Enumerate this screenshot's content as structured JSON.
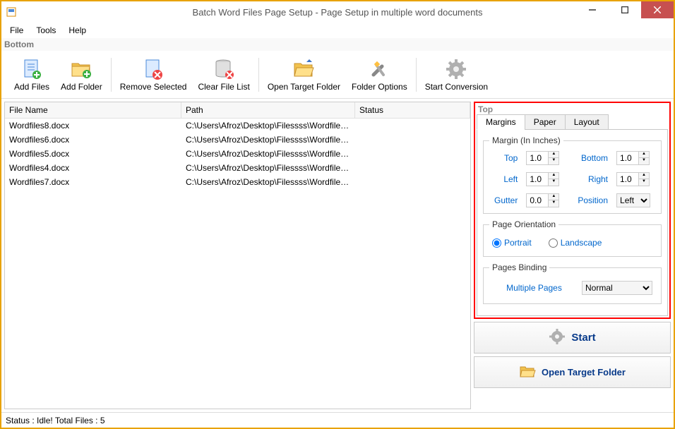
{
  "window": {
    "title": "Batch Word Files Page Setup - Page Setup in multiple word documents"
  },
  "menu": {
    "file": "File",
    "tools": "Tools",
    "help": "Help"
  },
  "labels": {
    "bottom": "Bottom",
    "top": "Top"
  },
  "toolbar": {
    "add_files": "Add Files",
    "add_folder": "Add Folder",
    "remove_selected": "Remove Selected",
    "clear_file_list": "Clear File List",
    "open_target_folder": "Open Target Folder",
    "folder_options": "Folder Options",
    "start_conversion": "Start Conversion"
  },
  "table": {
    "headers": {
      "filename": "File Name",
      "path": "Path",
      "status": "Status"
    },
    "rows": [
      {
        "name": "Wordfiles8.docx",
        "path": "C:\\Users\\Afroz\\Desktop\\Filessss\\Wordfiles8..."
      },
      {
        "name": "Wordfiles6.docx",
        "path": "C:\\Users\\Afroz\\Desktop\\Filessss\\Wordfiles6..."
      },
      {
        "name": "Wordfiles5.docx",
        "path": "C:\\Users\\Afroz\\Desktop\\Filessss\\Wordfiles5..."
      },
      {
        "name": "Wordfiles4.docx",
        "path": "C:\\Users\\Afroz\\Desktop\\Filessss\\Wordfiles4..."
      },
      {
        "name": "Wordfiles7.docx",
        "path": "C:\\Users\\Afroz\\Desktop\\Filessss\\Wordfiles7..."
      }
    ]
  },
  "tabs": {
    "margins": "Margins",
    "paper": "Paper",
    "layout": "Layout"
  },
  "margins": {
    "title": "Margin (In Inches)",
    "top": "Top",
    "top_v": "1.0",
    "bottom": "Bottom",
    "bottom_v": "1.0",
    "left": "Left",
    "left_v": "1.0",
    "right": "Right",
    "right_v": "1.0",
    "gutter": "Gutter",
    "gutter_v": "0.0",
    "position": "Position",
    "position_v": "Left"
  },
  "orientation": {
    "title": "Page Orientation",
    "portrait": "Portrait",
    "landscape": "Landscape"
  },
  "binding": {
    "title": "Pages Binding",
    "multiple_pages": "Multiple Pages",
    "value": "Normal"
  },
  "actions": {
    "start": "Start",
    "open_target": "Open Target Folder"
  },
  "status": "Status  :  Idle!  Total Files : 5"
}
